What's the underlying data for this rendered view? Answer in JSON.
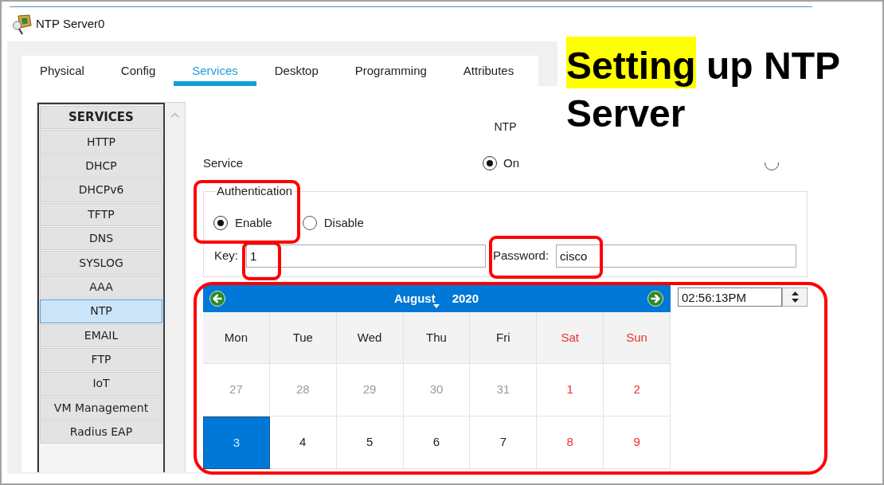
{
  "window": {
    "title": "NTP Server0"
  },
  "tabs": [
    {
      "label": "Physical",
      "selected": false
    },
    {
      "label": "Config",
      "selected": false
    },
    {
      "label": "Services",
      "selected": true
    },
    {
      "label": "Desktop",
      "selected": false
    },
    {
      "label": "Programming",
      "selected": false
    },
    {
      "label": "Attributes",
      "selected": false
    }
  ],
  "sidebar": {
    "header": "SERVICES",
    "items": [
      {
        "label": "HTTP",
        "selected": false
      },
      {
        "label": "DHCP",
        "selected": false
      },
      {
        "label": "DHCPv6",
        "selected": false
      },
      {
        "label": "TFTP",
        "selected": false
      },
      {
        "label": "DNS",
        "selected": false
      },
      {
        "label": "SYSLOG",
        "selected": false
      },
      {
        "label": "AAA",
        "selected": false
      },
      {
        "label": "NTP",
        "selected": true
      },
      {
        "label": "EMAIL",
        "selected": false
      },
      {
        "label": "FTP",
        "selected": false
      },
      {
        "label": "IoT",
        "selected": false
      },
      {
        "label": "VM Management",
        "selected": false
      },
      {
        "label": "Radius EAP",
        "selected": false
      }
    ]
  },
  "ntp": {
    "heading": "NTP",
    "service": {
      "label": "Service",
      "options": [
        {
          "label": "On",
          "selected": true
        },
        {
          "selected": false
        }
      ]
    },
    "authentication": {
      "legend": "Authentication",
      "framed": true,
      "options": [
        {
          "label": "Enable",
          "selected": true
        },
        {
          "label": "Disable",
          "selected": false
        }
      ],
      "key": {
        "label": "Key:",
        "value": "1",
        "framed": true
      },
      "password": {
        "label": "Password:",
        "value": "cisco",
        "framed": true
      }
    },
    "calendar": {
      "framed": true,
      "month": "August",
      "year": "2020",
      "weekdays": [
        {
          "label": "Mon",
          "weekend": false
        },
        {
          "label": "Tue",
          "weekend": false
        },
        {
          "label": "Wed",
          "weekend": false
        },
        {
          "label": "Thu",
          "weekend": false
        },
        {
          "label": "Fri",
          "weekend": false
        },
        {
          "label": "Sat",
          "weekend": true
        },
        {
          "label": "Sun",
          "weekend": true
        }
      ],
      "weeks": [
        [
          {
            "label": "27",
            "outside_month": true,
            "weekend": false,
            "selected": false
          },
          {
            "label": "28",
            "outside_month": true,
            "weekend": false,
            "selected": false
          },
          {
            "label": "29",
            "outside_month": true,
            "weekend": false,
            "selected": false
          },
          {
            "label": "30",
            "outside_month": true,
            "weekend": false,
            "selected": false
          },
          {
            "label": "31",
            "outside_month": true,
            "weekend": false,
            "selected": false
          },
          {
            "label": "1",
            "outside_month": false,
            "weekend": true,
            "selected": false
          },
          {
            "label": "2",
            "outside_month": false,
            "weekend": true,
            "selected": false
          }
        ],
        [
          {
            "label": "3",
            "outside_month": false,
            "weekend": false,
            "selected": true
          },
          {
            "label": "4",
            "outside_month": false,
            "weekend": false,
            "selected": false
          },
          {
            "label": "5",
            "outside_month": false,
            "weekend": false,
            "selected": false
          },
          {
            "label": "6",
            "outside_month": false,
            "weekend": false,
            "selected": false
          },
          {
            "label": "7",
            "outside_month": false,
            "weekend": false,
            "selected": false
          },
          {
            "label": "8",
            "outside_month": false,
            "weekend": true,
            "selected": false
          },
          {
            "label": "9",
            "outside_month": false,
            "weekend": true,
            "selected": false
          }
        ]
      ]
    },
    "time": {
      "value": "02:56:13PM"
    }
  },
  "slide_title": {
    "parts": [
      {
        "text": "Setting",
        "highlighted": true
      },
      {
        "text": "up NTP Server",
        "highlighted": false
      }
    ]
  }
}
